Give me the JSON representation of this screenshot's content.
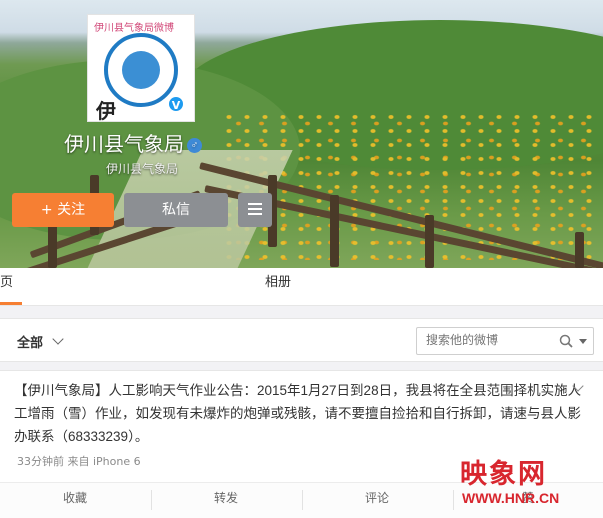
{
  "profile": {
    "name": "伊川县气象局",
    "subname": "伊川县气象局",
    "avatar_top_text": "伊川县气象局微博",
    "avatar_char": "伊",
    "verified_mark": "V",
    "gender_mark": "♂"
  },
  "actions": {
    "follow_label": "+ 关注",
    "message_label": "私信"
  },
  "tabs": {
    "home": "主页",
    "album": "相册"
  },
  "filter": {
    "all_label": "全部",
    "search_placeholder": "搜索他的微博"
  },
  "post": {
    "text": "【伊川气象局】人工影响天气作业公告：2015年1月27日到28日，我县将在全县范围择机实施人工增雨（雪）作业，如发现有未爆炸的炮弹或残骸，请不要擅自捡拾和自行拆卸，请速与县人影办联系（68333239）。",
    "meta": "33分钟前 来自 iPhone 6",
    "buttons": [
      "收藏",
      "转发",
      "评论",
      "赞"
    ]
  },
  "watermark": {
    "logo": "映象网",
    "url": "WWW.HNR.CN"
  },
  "colors": {
    "accent_orange": "#f67f33",
    "button_gray": "#8c8f93",
    "watermark_red": "#d8262e",
    "verified_blue": "#1d9bf0"
  },
  "icons": [
    "chevron-down-icon",
    "search-icon",
    "caret-down-icon",
    "menu-icon",
    "verified-icon",
    "male-icon"
  ]
}
